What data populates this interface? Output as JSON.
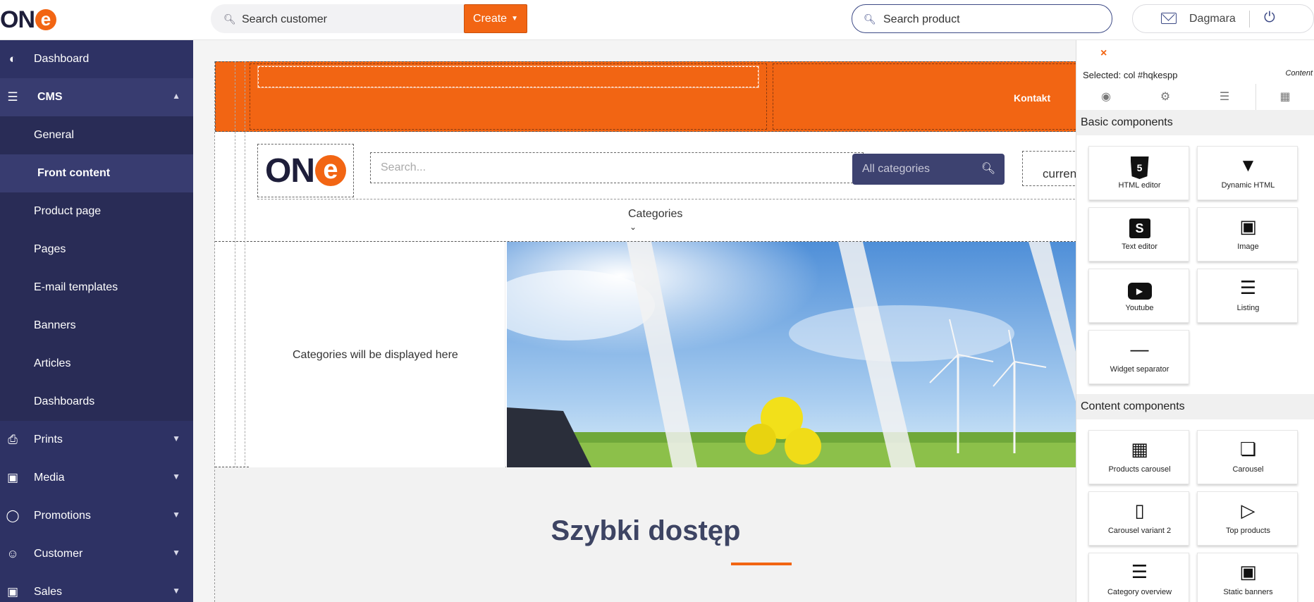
{
  "brand": {
    "logo_text": "ON",
    "logo_e": "e",
    "accent": "#f26513",
    "nav_bg": "#2e3264"
  },
  "topbar": {
    "search_customer_placeholder": "Search customer",
    "create_label": "Create",
    "search_product_placeholder": "Search product",
    "user_name": "Dagmara"
  },
  "sidebar": {
    "items": [
      {
        "label": "Dashboard",
        "icon": "gauge-icon"
      },
      {
        "label": "CMS",
        "icon": "layers-icon"
      },
      {
        "label": "General"
      },
      {
        "label": "Front content"
      },
      {
        "label": "Product page"
      },
      {
        "label": "Pages"
      },
      {
        "label": "E-mail templates"
      },
      {
        "label": "Banners"
      },
      {
        "label": "Articles"
      },
      {
        "label": "Dashboards"
      },
      {
        "label": "Prints",
        "icon": "printer-icon"
      },
      {
        "label": "Media",
        "icon": "image-icon"
      },
      {
        "label": "Promotions",
        "icon": "award-icon"
      },
      {
        "label": "Customer",
        "icon": "users-icon"
      },
      {
        "label": "Sales",
        "icon": "basket-icon"
      }
    ]
  },
  "canvas": {
    "kontakt": "Kontakt",
    "shop_search_placeholder": "Search...",
    "all_categories": "All categories",
    "currency_partial": "curren",
    "categories_label": "Categories",
    "categories_placeholder": "Categories will be displayed here",
    "quick_access_title": "Szybki dostęp"
  },
  "panel": {
    "close": "×",
    "selected": "Selected: col #hqkespp",
    "content_tag": "Content",
    "basic_header": "Basic components",
    "basic": [
      "HTML editor",
      "Dynamic HTML",
      "Text editor",
      "Image",
      "Youtube",
      "Listing",
      "Widget separator"
    ],
    "content_header": "Content components",
    "content": [
      "Products carousel",
      "Carousel",
      "Carousel variant 2",
      "Top products",
      "Category overview",
      "Static banners"
    ]
  }
}
